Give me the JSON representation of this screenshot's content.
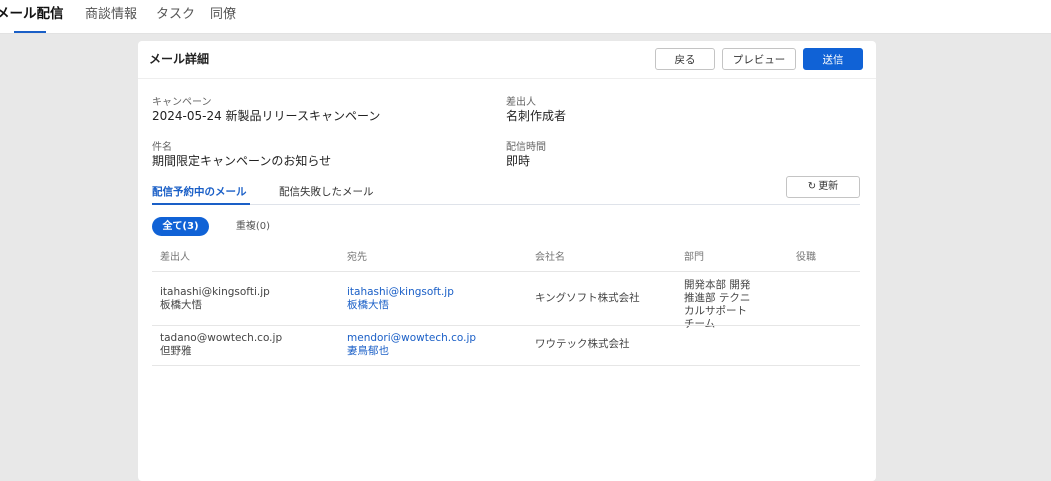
{
  "nav": {
    "tabs": [
      "メール配信",
      "商談情報",
      "タスク",
      "同僚"
    ],
    "active_index": 0
  },
  "panel": {
    "title": "メール詳細",
    "buttons": {
      "back": "戻る",
      "preview": "プレビュー",
      "send": "送信"
    }
  },
  "fields": {
    "campaign": {
      "label": "キャンペーン",
      "value": "2024-05-24 新製品リリースキャンペーン"
    },
    "sender": {
      "label": "差出人",
      "value": "名刺作成者"
    },
    "subject": {
      "label": "件名",
      "value": "期間限定キャンペーンのお知らせ"
    },
    "delivery_time": {
      "label": "配信時間",
      "value": "即時"
    }
  },
  "subtabs": [
    "配信予約中のメール",
    "配信失敗したメール"
  ],
  "refresh_label": "更新",
  "filters": {
    "all": "全て(3)",
    "duplicate": "重複(0)"
  },
  "table": {
    "headers": [
      "差出人",
      "宛先",
      "会社名",
      "部門",
      "役職"
    ],
    "rows": [
      {
        "sender_email": "itahashi@kingsofti.jp",
        "sender_name": "板橋大悟",
        "to_email": "itahashi@kingsoft.jp",
        "to_name": "板橋大悟",
        "company": "キングソフト株式会社",
        "department": "開発本部 開発推進部 テクニカルサポートチーム",
        "title": ""
      },
      {
        "sender_email": "tadano@wowtech.co.jp",
        "sender_name": "但野雅",
        "to_email": "mendori@wowtech.co.jp",
        "to_name": "妻鳥郁也",
        "company": "ワウテック株式会社",
        "department": "",
        "title": ""
      }
    ]
  }
}
